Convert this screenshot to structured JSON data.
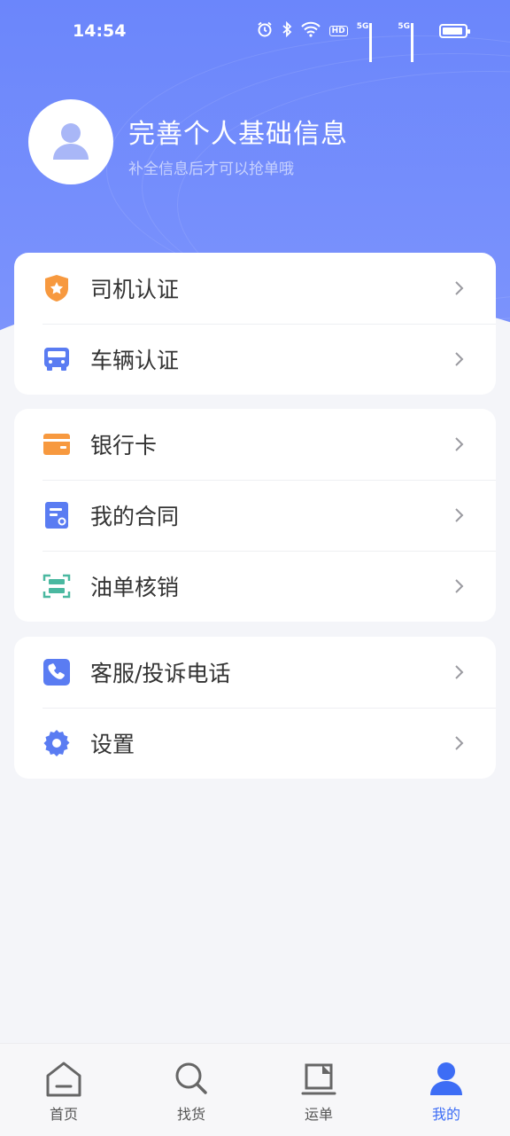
{
  "status_bar": {
    "time": "14:54",
    "network_1": "5G",
    "network_2": "5G",
    "hd_label": "HD"
  },
  "profile": {
    "title": "完善个人基础信息",
    "subtitle": "补全信息后才可以抢单哦"
  },
  "groups": [
    {
      "items": [
        {
          "label": "司机认证",
          "icon": "shield-star-icon",
          "color": "#f7993f"
        },
        {
          "label": "车辆认证",
          "icon": "truck-icon",
          "color": "#5a7cf2"
        }
      ]
    },
    {
      "items": [
        {
          "label": "银行卡",
          "icon": "bank-card-icon",
          "color": "#f7993f"
        },
        {
          "label": "我的合同",
          "icon": "contract-icon",
          "color": "#5a7cf2"
        },
        {
          "label": "油单核销",
          "icon": "scan-icon",
          "color": "#4ab8a0"
        }
      ]
    },
    {
      "items": [
        {
          "label": "客服/投诉电话",
          "icon": "phone-icon",
          "color": "#5a7cf2"
        },
        {
          "label": "设置",
          "icon": "gear-icon",
          "color": "#5a7cf2"
        }
      ]
    }
  ],
  "tabs": [
    {
      "label": "首页",
      "icon": "home-icon",
      "active": false
    },
    {
      "label": "找货",
      "icon": "search-icon",
      "active": false
    },
    {
      "label": "运单",
      "icon": "waybill-icon",
      "active": false
    },
    {
      "label": "我的",
      "icon": "user-icon",
      "active": true
    }
  ],
  "colors": {
    "header": "#6b86fb",
    "accent": "#3d6df5",
    "background": "#f4f5f9"
  }
}
